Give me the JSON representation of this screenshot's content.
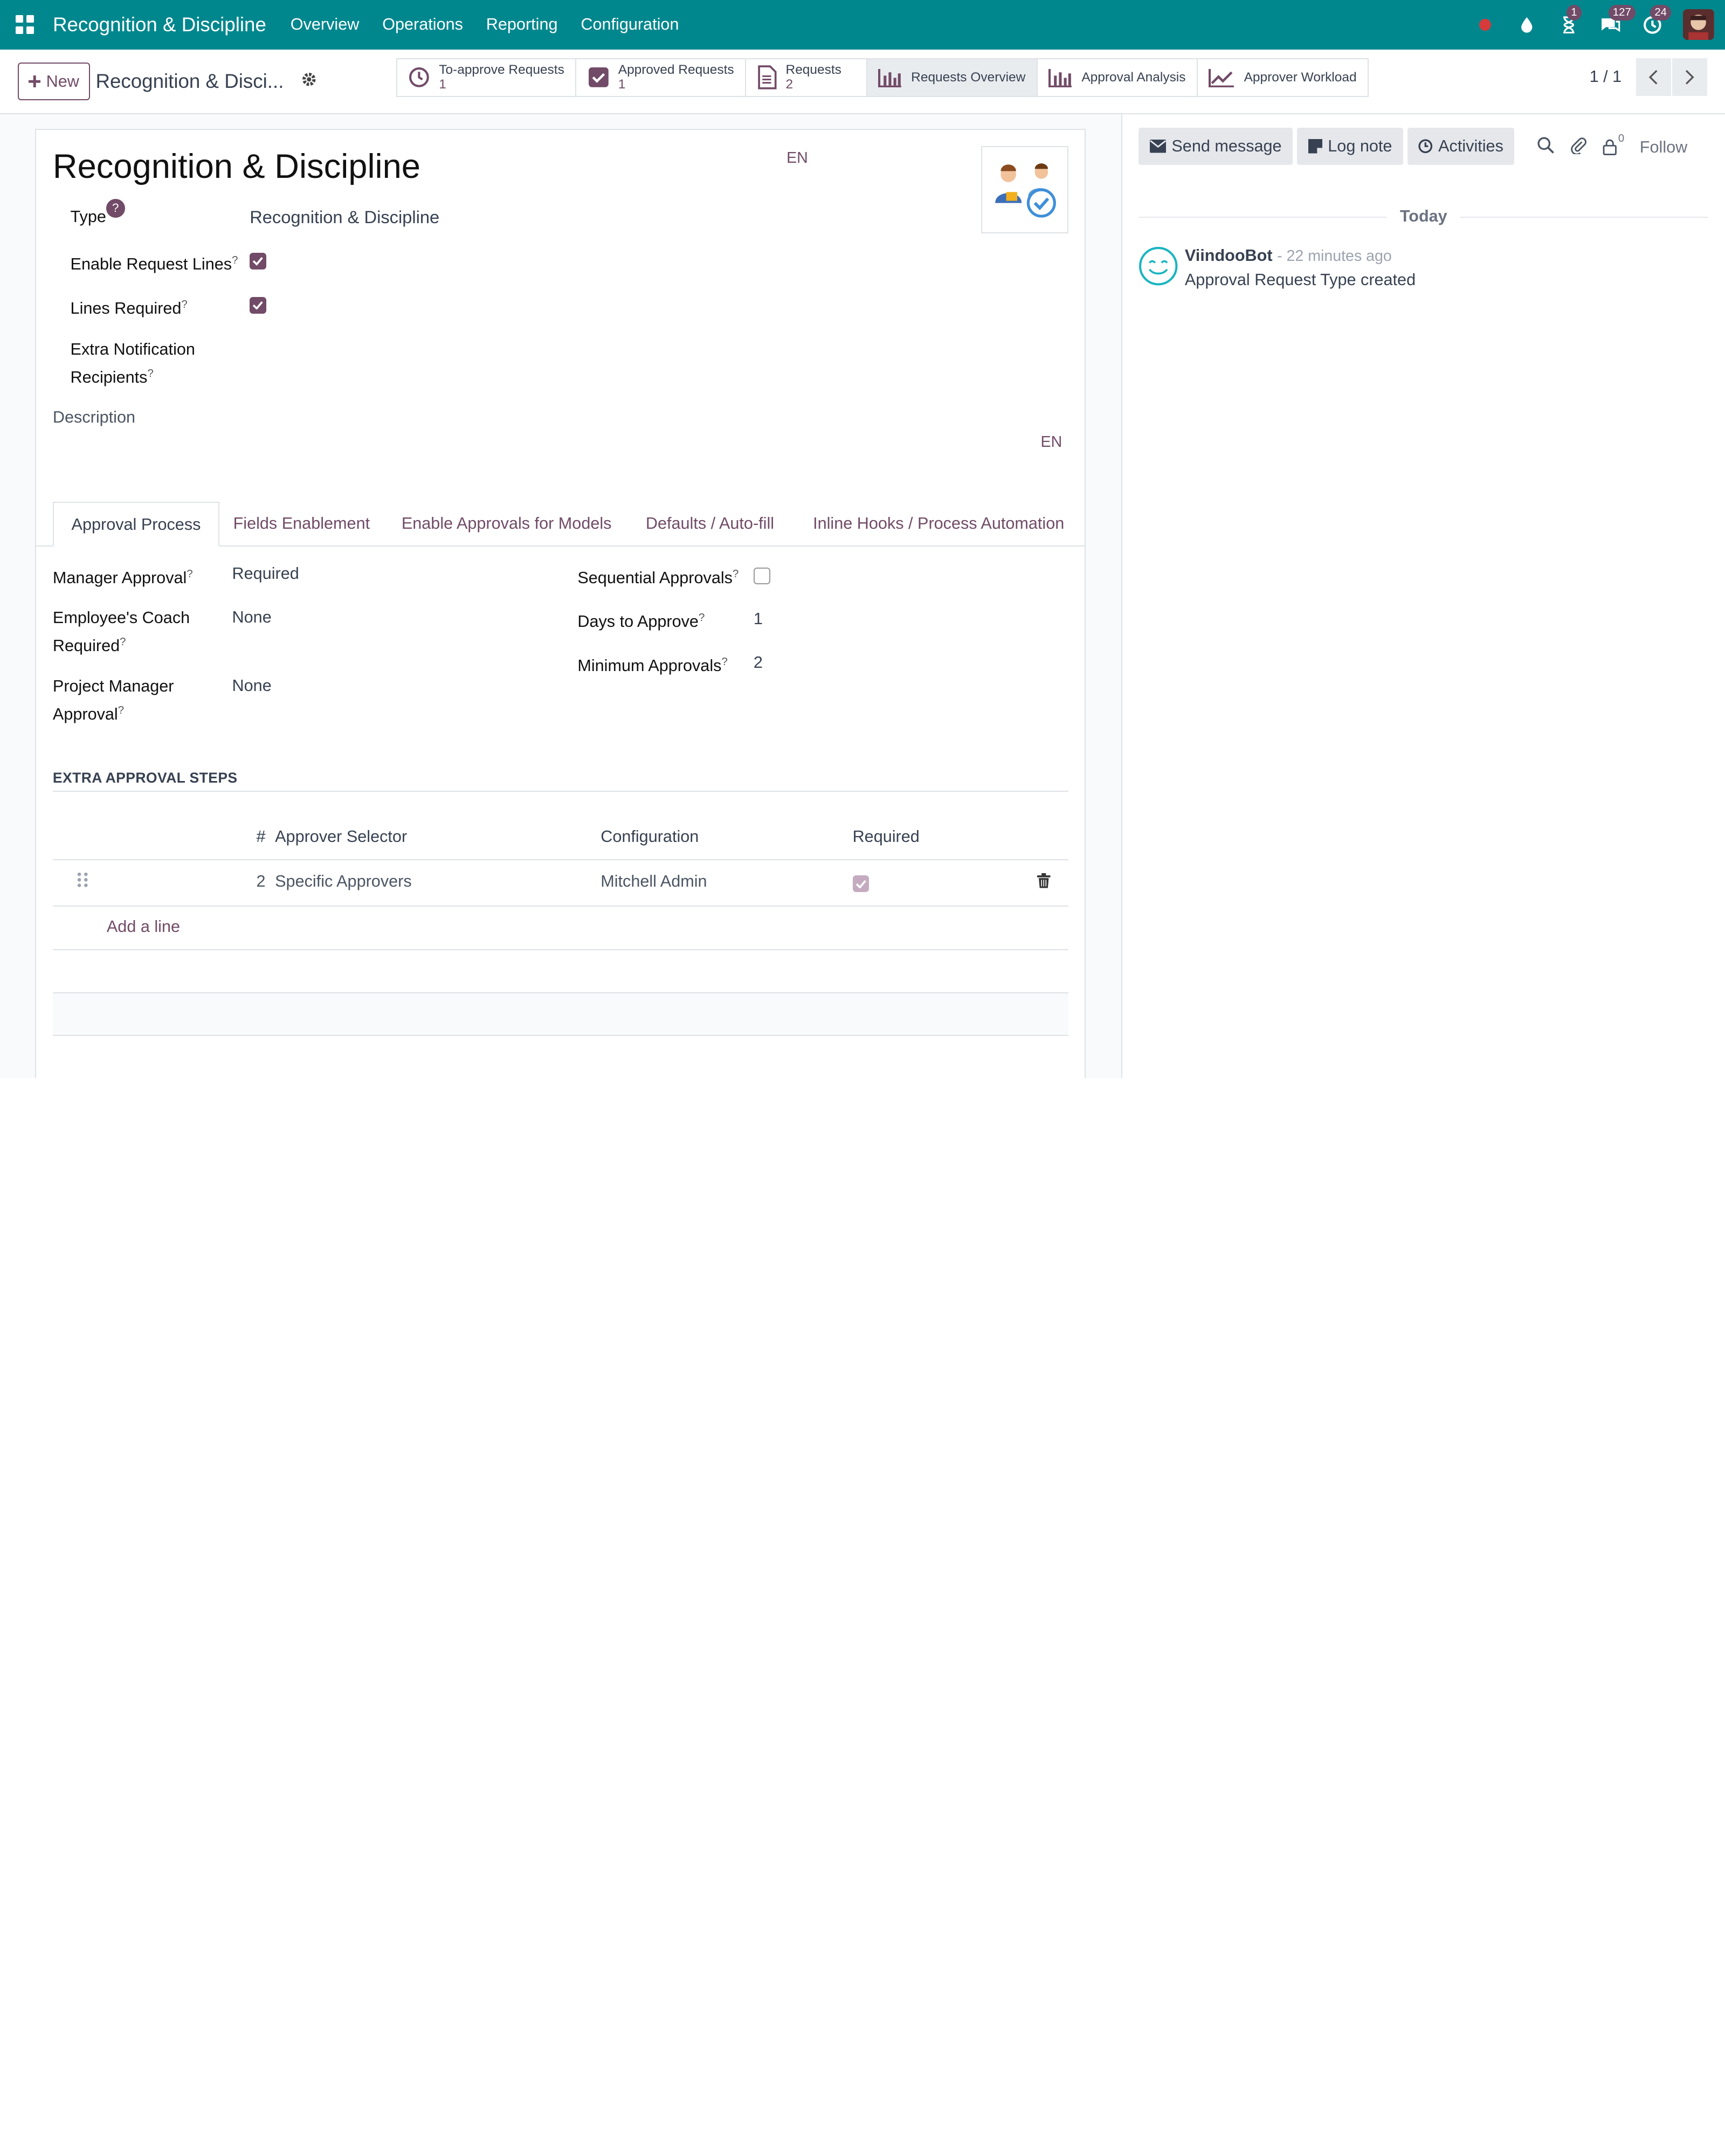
{
  "navbar": {
    "app_name": "Recognition & Discipline",
    "menus": [
      "Overview",
      "Operations",
      "Reporting",
      "Configuration"
    ],
    "activity_badge": "1",
    "messages_badge": "127",
    "clock_badge": "24"
  },
  "control": {
    "new_label": "New",
    "breadcrumb": "Recognition & Disci...",
    "pager": "1 / 1",
    "smart_buttons": [
      {
        "label": "To-approve Requests",
        "count": "1",
        "icon": "clock-icon"
      },
      {
        "label": "Approved Requests",
        "count": "1",
        "icon": "check-square-icon"
      },
      {
        "label": "Requests",
        "count": "2",
        "icon": "document-icon"
      },
      {
        "label": "Requests Overview",
        "icon": "bar-chart-icon"
      },
      {
        "label": "Approval Analysis",
        "icon": "bar-chart-icon"
      },
      {
        "label": "Approver Workload",
        "icon": "line-chart-icon"
      }
    ]
  },
  "form": {
    "title": "Recognition & Discipline",
    "lang": "EN",
    "type_label": "Type",
    "type_help": "?",
    "type_value": "Recognition & Discipline",
    "enable_lines_label": "Enable Request Lines",
    "lines_required_label": "Lines Required",
    "extra_notif_label_1": "Extra Notification",
    "extra_notif_label_2": "Recipients",
    "description_label": "Description",
    "help_mark": "?"
  },
  "tabs": [
    "Approval Process",
    "Fields Enablement",
    "Enable Approvals for Models",
    "Defaults / Auto-fill",
    "Inline Hooks / Process Automation"
  ],
  "approval": {
    "manager_label": "Manager Approval",
    "manager_value": "Required",
    "coach_label_1": "Employee's Coach",
    "coach_label_2": "Required",
    "coach_value": "None",
    "pm_label_1": "Project Manager",
    "pm_label_2": "Approval",
    "pm_value": "None",
    "sequential_label": "Sequential Approvals",
    "days_label": "Days to Approve",
    "days_value": "1",
    "min_label": "Minimum Approvals",
    "min_value": "2"
  },
  "steps": {
    "title": "EXTRA APPROVAL STEPS",
    "headers": {
      "num": "#",
      "selector": "Approver Selector",
      "config": "Configuration",
      "required": "Required"
    },
    "rows": [
      {
        "num": "2",
        "selector": "Specific Approvers",
        "config": "Mitchell Admin"
      }
    ],
    "add_line": "Add a line"
  },
  "chatter": {
    "send_message": "Send message",
    "log_note": "Log note",
    "activities": "Activities",
    "followers_count": "0",
    "follow": "Follow",
    "today": "Today",
    "author": "ViindooBot",
    "date": "- 22 minutes ago",
    "body": "Approval Request Type created"
  },
  "colors": {
    "navbar": "#00878e",
    "accent": "#714b67"
  }
}
